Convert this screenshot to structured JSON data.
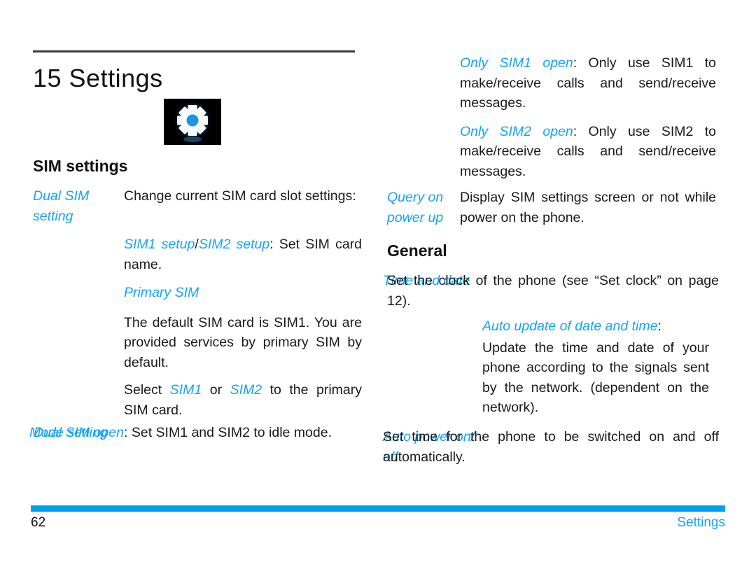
{
  "document": {
    "chapter_number": "15",
    "chapter_title": "15 Settings",
    "icon_name": "gear-icon"
  },
  "footer": {
    "page_number": "62",
    "section_label": "Settings"
  },
  "left_column": {
    "heading": "SIM settings",
    "rows": [
      {
        "term": "Dual SIM setting",
        "term_line1": "Dual SIM",
        "term_line2": "setting",
        "desc": "Change current SIM card slot settings:"
      }
    ],
    "sub_entries": [
      {
        "term": "SIM1 setup",
        "separator": "/",
        "term2": "SIM2 setup",
        "colon": ": ",
        "desc": "Set SIM card name."
      },
      {
        "term": "Primary SIM",
        "paragraphs": [
          "The default SIM card is SIM1. You are provided services by  primary SIM by default.",
          "Select SIM1 or SIM2 to  the primary SIM card."
        ],
        "select_prefix": "Select ",
        "select_sim1": "SIM1",
        "select_mid": " or ",
        "select_sim2": "SIM2",
        "select_suffix": " to   the primary SIM card."
      }
    ],
    "mode_row": {
      "term": "Mode setting",
      "sub_term": "Dual SIM open",
      "colon": ": ",
      "desc": "Set SIM1 and SIM2 to idle mode."
    }
  },
  "right_column": {
    "top_entries": [
      {
        "term": "Only SIM1 open",
        "colon": ": ",
        "desc": "Only use SIM1 to make/receive calls and send/receive messages."
      },
      {
        "term": "Only SIM2 open",
        "colon": ": ",
        "desc": "Only use SIM2 to make/receive calls and send/receive messages."
      }
    ],
    "query_row": {
      "term_line1": "Query on",
      "term_line2": "power up",
      "desc": "Display SIM settings screen or not while power on the phone."
    },
    "heading": "General",
    "time_row": {
      "term": "Time and date",
      "desc": "Set the clock of the phone (see “Set clock” on page 12)."
    },
    "auto_update": {
      "term": "Auto update of date and time",
      "colon": ":",
      "desc": "Update the time and date of your phone according to the signals sent by the network. (dependent on the network)."
    },
    "auto_power_row": {
      "term_line1": "Auto power on/",
      "term_line2": "off",
      "desc": "Set time for the phone to be switched on and off automatically."
    }
  },
  "colors": {
    "accent_blue": "#16A3F0",
    "footer_bar": "#00A0F0",
    "rule_gray": "#3A3A3A",
    "text_black": "#1A1A1A"
  }
}
